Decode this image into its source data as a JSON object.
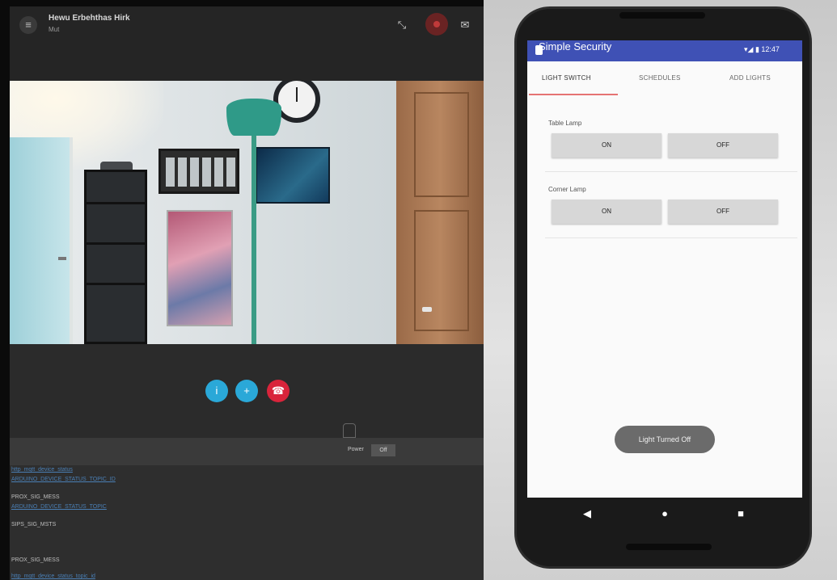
{
  "call": {
    "title": "Hewu Erbehthas Hirk",
    "subtitle": "Mut",
    "header_icons": {
      "menu": "menu-icon",
      "minimize": "collapse-icon",
      "record": "record-icon",
      "chat": "chat-bubble-icon"
    },
    "controls": [
      {
        "name": "mic-button",
        "icon": "i",
        "color": "#2aa8d8"
      },
      {
        "name": "video-button",
        "icon": "+",
        "color": "#2aa8d8"
      },
      {
        "name": "end-call-button",
        "icon": "☎",
        "color": "#d9243b"
      }
    ],
    "status": {
      "label": "Power",
      "value": "Off"
    },
    "log": [
      {
        "text": "http_mqtt_device_status",
        "kind": "link"
      },
      {
        "text": "ARDUINO_DEVICE_STATUS_TOPIC_ID",
        "kind": "link"
      },
      {
        "text": "PROX_SIG_MESS",
        "kind": "plain"
      },
      {
        "text": "ARDUINO_DEVICE_STATUS_TOPIC",
        "kind": "link"
      },
      {
        "text": "SIPS_SIG_MSTS",
        "kind": "plain"
      },
      {
        "text": "PROX_SIG_MESS",
        "kind": "plain"
      },
      {
        "text": "http_mqtt_device_status_topic_id",
        "kind": "link"
      }
    ]
  },
  "phone": {
    "app_title": "Simple Security",
    "status_icons": "▾◢ ▮ 12:47",
    "tabs": [
      {
        "label": "LIGHT SWITCH",
        "active": true
      },
      {
        "label": "SCHEDULES",
        "active": false
      },
      {
        "label": "ADD LIGHTS",
        "active": false
      }
    ],
    "lamps": [
      {
        "name": "Table Lamp",
        "on_label": "ON",
        "off_label": "OFF"
      },
      {
        "name": "Corner Lamp",
        "on_label": "ON",
        "off_label": "OFF"
      }
    ],
    "toast": "Light Turned Off",
    "nav": {
      "back": "◀",
      "home": "●",
      "recent": "■"
    }
  },
  "colors": {
    "appbar": "#3f51b5",
    "tab_indicator": "#e57373",
    "call_accent": "#2aa8d8",
    "end_call": "#d9243b"
  }
}
